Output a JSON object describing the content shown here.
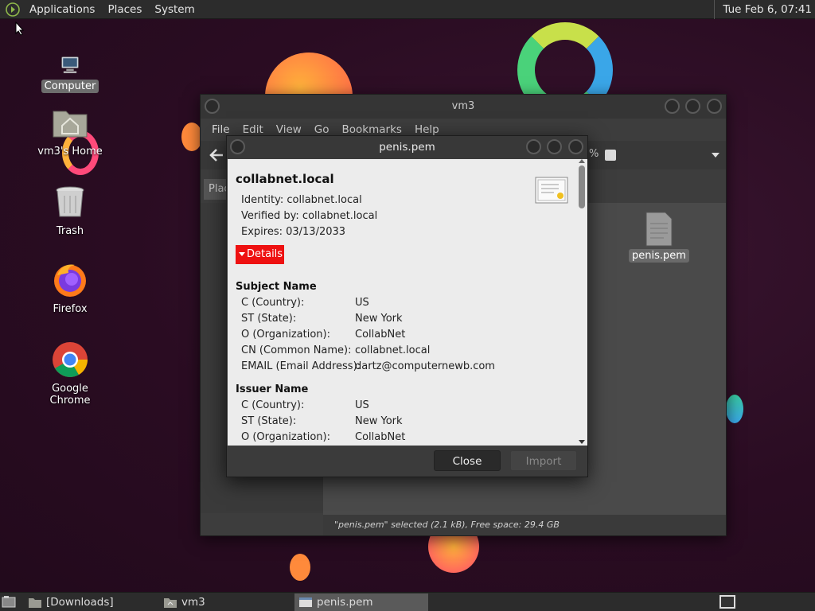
{
  "top_panel": {
    "menus": [
      "Applications",
      "Places",
      "System"
    ],
    "clock": "Tue Feb  6, 07:41"
  },
  "desktop_icons": [
    {
      "label": "Computer",
      "icon": "computer-icon",
      "selected": true
    },
    {
      "label": "vm3's Home",
      "icon": "home-folder-icon",
      "selected": false
    },
    {
      "label": "Trash",
      "icon": "trash-icon",
      "selected": false
    },
    {
      "label": "Firefox",
      "icon": "firefox-icon",
      "selected": false
    },
    {
      "label": "Google Chrome",
      "icon": "chrome-icon",
      "selected": false
    }
  ],
  "file_manager": {
    "title": "vm3",
    "menus": [
      "File",
      "Edit",
      "View",
      "Go",
      "Bookmarks",
      "Help"
    ],
    "places_tab": "Plac",
    "file_label": "penis.pem",
    "status": "\"penis.pem\" selected (2.1 kB), Free space: 29.4 GB"
  },
  "certificate_dialog": {
    "title": "penis.pem",
    "common_name": "collabnet.local",
    "identity": "Identity: collabnet.local",
    "verified_by": "Verified by: collabnet.local",
    "expires": "Expires: 03/13/2033",
    "details_label": "Details",
    "subject": {
      "heading": "Subject Name",
      "fields": [
        {
          "key": "C (Country):",
          "value": "US"
        },
        {
          "key": "ST (State):",
          "value": "New York"
        },
        {
          "key": "O (Organization):",
          "value": "CollabNet"
        },
        {
          "key": "CN (Common Name):",
          "value": "collabnet.local"
        },
        {
          "key": "EMAIL (Email Address):",
          "value": "dartz@computernewb.com"
        }
      ]
    },
    "issuer": {
      "heading": "Issuer Name",
      "fields": [
        {
          "key": "C (Country):",
          "value": "US"
        },
        {
          "key": "ST (State):",
          "value": "New York"
        },
        {
          "key": "O (Organization):",
          "value": "CollabNet"
        }
      ]
    },
    "close_label": "Close",
    "import_label": "Import"
  },
  "taskbar": {
    "tasks": [
      {
        "label": "[Downloads]",
        "icon": "folder-icon",
        "active": false
      },
      {
        "label": "vm3",
        "icon": "home-folder-icon",
        "active": false
      },
      {
        "label": "penis.pem",
        "icon": "window-icon",
        "active": true
      }
    ]
  },
  "colors": {
    "panel_bg": "#2c2c2c",
    "desktop_bg": "#2a0c22",
    "details_red": "#ee1111",
    "dialog_content_bg": "#ececec"
  }
}
